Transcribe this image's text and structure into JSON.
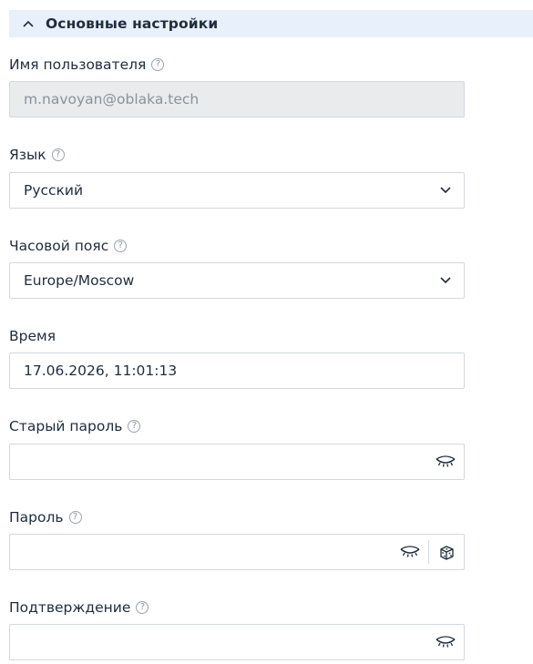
{
  "section": {
    "title": "Основные настройки",
    "expanded": true
  },
  "fields": {
    "username": {
      "label": "Имя пользователя",
      "value": "m.navoyan@oblaka.tech",
      "disabled": true,
      "help": "?"
    },
    "language": {
      "label": "Язык",
      "value": "Русский",
      "help": "?"
    },
    "timezone": {
      "label": "Часовой пояс",
      "value": "Europe/Moscow",
      "help": "?"
    },
    "time": {
      "label": "Время",
      "value": "17.06.2026, 11:01:13"
    },
    "old_password": {
      "label": "Старый пароль",
      "value": "",
      "help": "?"
    },
    "password": {
      "label": "Пароль",
      "value": "",
      "help": "?"
    },
    "confirm": {
      "label": "Подтверждение",
      "value": "",
      "help": "?"
    }
  },
  "icons": {
    "section_toggle": "chevron-up-icon",
    "select_caret": "chevron-down-icon",
    "password_visibility": "eye-closed-icon",
    "password_generate": "dice-icon",
    "help": "question-mark-icon"
  },
  "colors": {
    "section_header_bg": "#e8f0fb",
    "input_border": "#d3d8de",
    "disabled_bg": "#e9ebed",
    "text": "#1f2d3d",
    "muted_text": "#8a929a"
  }
}
